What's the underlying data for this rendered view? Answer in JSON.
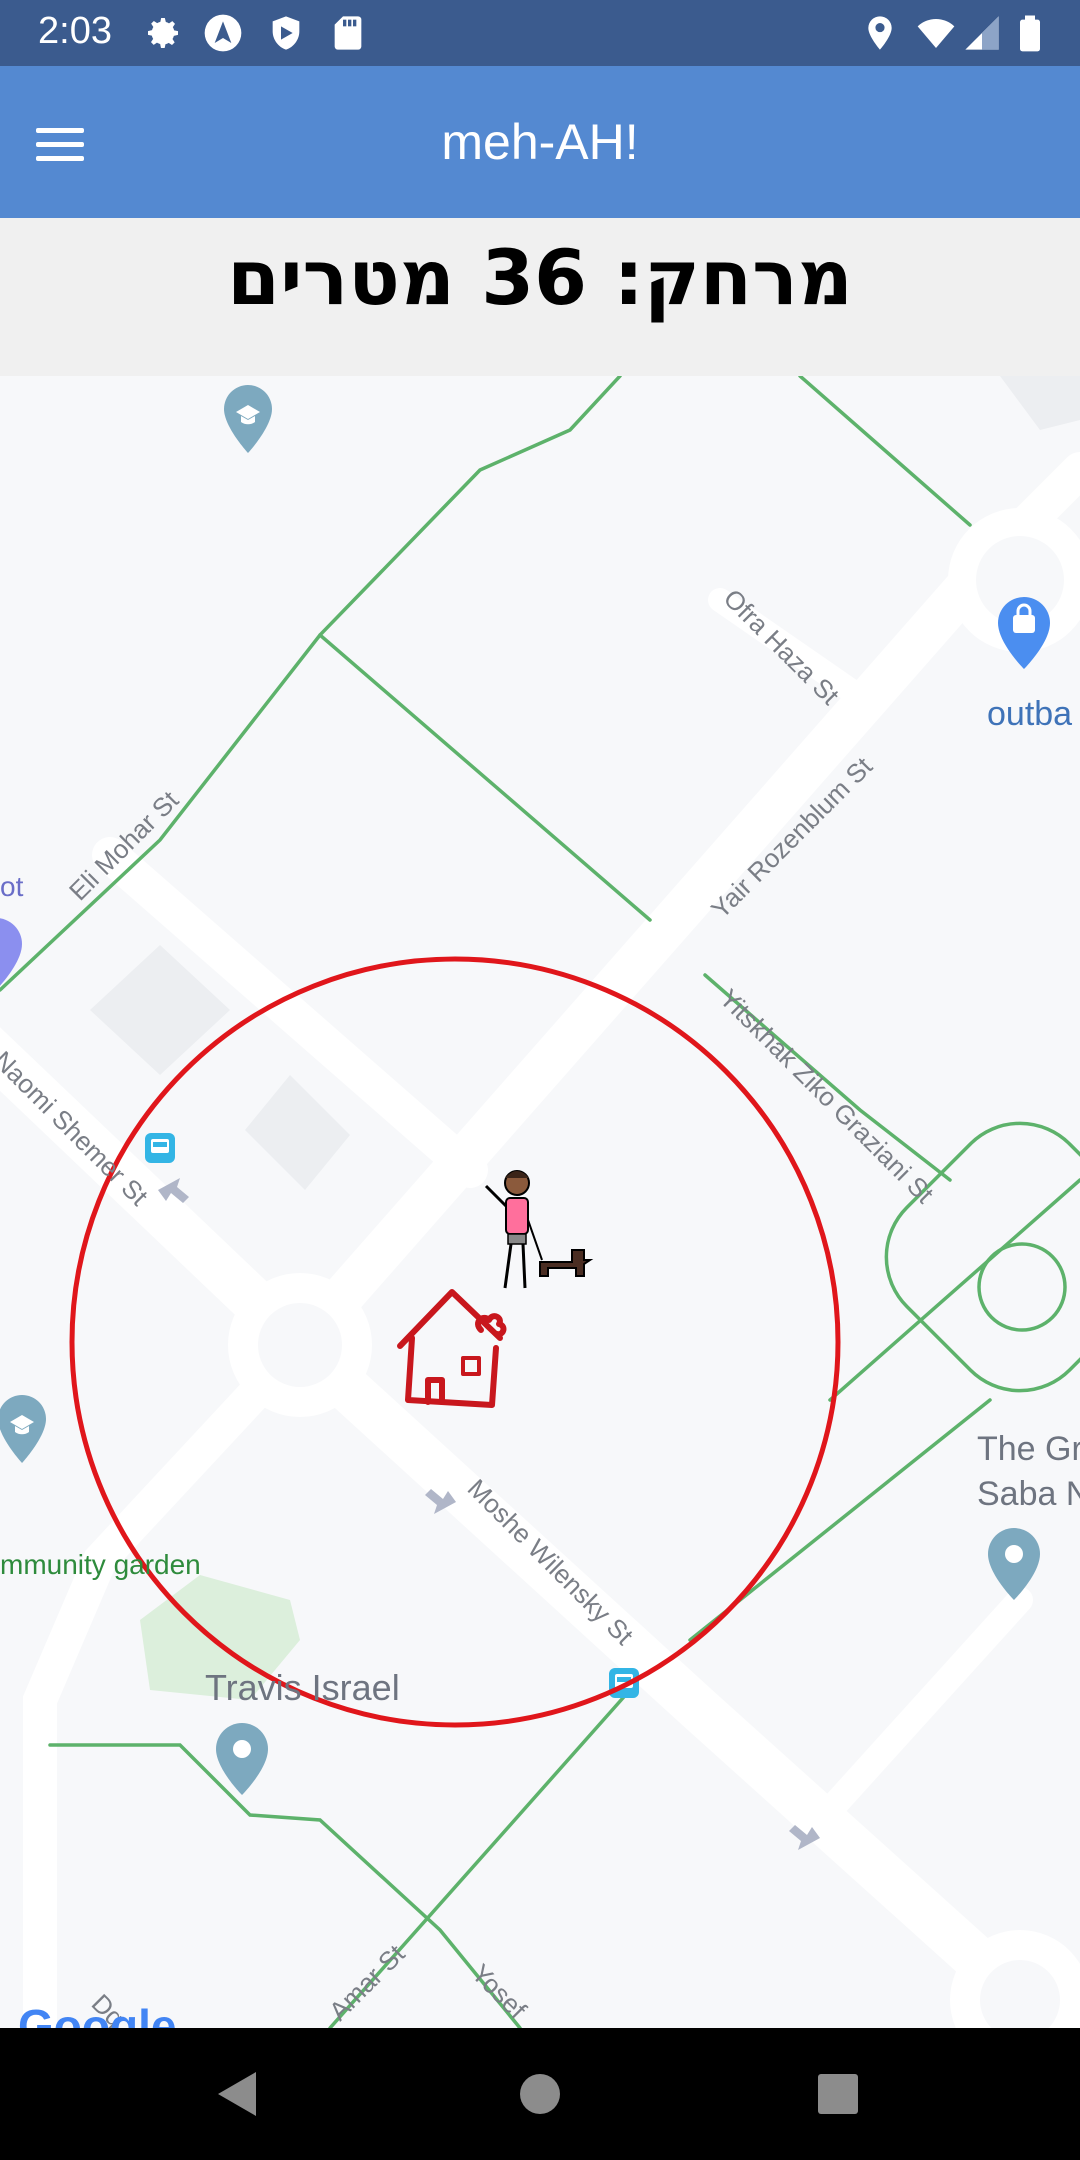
{
  "status_bar": {
    "time": "2:03",
    "icons": [
      "gear-icon",
      "navigation-app-icon",
      "shield-icon",
      "sd-card-icon",
      "location-icon",
      "wifi-icon",
      "cell-signal-icon",
      "battery-icon"
    ]
  },
  "app_bar": {
    "title": "meh-AH!",
    "menu_icon": "hamburger-menu-icon"
  },
  "distance": {
    "text": "מרחק: 36 מטרים"
  },
  "map": {
    "streets": [
      "Ofra Haza St",
      "Yair Rozenblum St",
      "Eli Mohar St",
      "Yitskhak Ziko Graziani St",
      "Naomi Shemer St",
      "Moshe Wilensky St",
      "Amar St",
      "Yosef",
      "Dq"
    ],
    "places": [
      "outba",
      "ot",
      "The Gr",
      "Saba N",
      "mmunity garden",
      "Travis Israel"
    ],
    "attribution": "Google",
    "geofence_color": "#e0161b",
    "road_green": "#5db26b"
  },
  "nav_bar": {
    "back": "back-icon",
    "home": "home-icon",
    "recents": "recents-icon"
  }
}
